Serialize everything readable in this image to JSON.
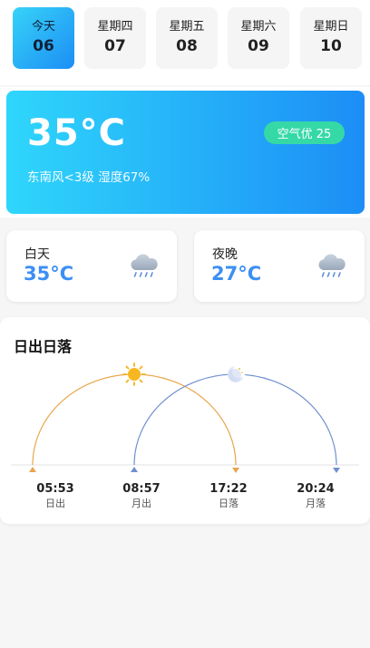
{
  "days": [
    {
      "name": "今天",
      "num": "06",
      "active": true
    },
    {
      "name": "星期四",
      "num": "07",
      "active": false
    },
    {
      "name": "星期五",
      "num": "08",
      "active": false
    },
    {
      "name": "星期六",
      "num": "09",
      "active": false
    },
    {
      "name": "星期日",
      "num": "10",
      "active": false
    }
  ],
  "current": {
    "temperature": "35°C",
    "aqi": "空气优 25",
    "wind_humidity": "东南风<3级 湿度67%"
  },
  "daytime": {
    "label": "白天",
    "temperature": "35°C",
    "icon": "rain-cloud-icon"
  },
  "night": {
    "label": "夜晚",
    "temperature": "27°C",
    "icon": "rain-cloud-icon"
  },
  "sun": {
    "title": "日出日落",
    "stats": [
      {
        "time": "05:53",
        "label": "日出"
      },
      {
        "time": "08:57",
        "label": "月出"
      },
      {
        "time": "17:22",
        "label": "日落"
      },
      {
        "time": "20:24",
        "label": "月落"
      }
    ],
    "sun_icon": "sun-icon",
    "moon_icon": "moon-icon"
  },
  "colors": {
    "accent_start": "#2fd6fb",
    "accent_end": "#1c8ef6",
    "aqi_green": "#35d9a6",
    "temp_blue": "#3c8ff4",
    "sun_arc": "#e8a54c",
    "moon_arc": "#6f8fd0"
  }
}
